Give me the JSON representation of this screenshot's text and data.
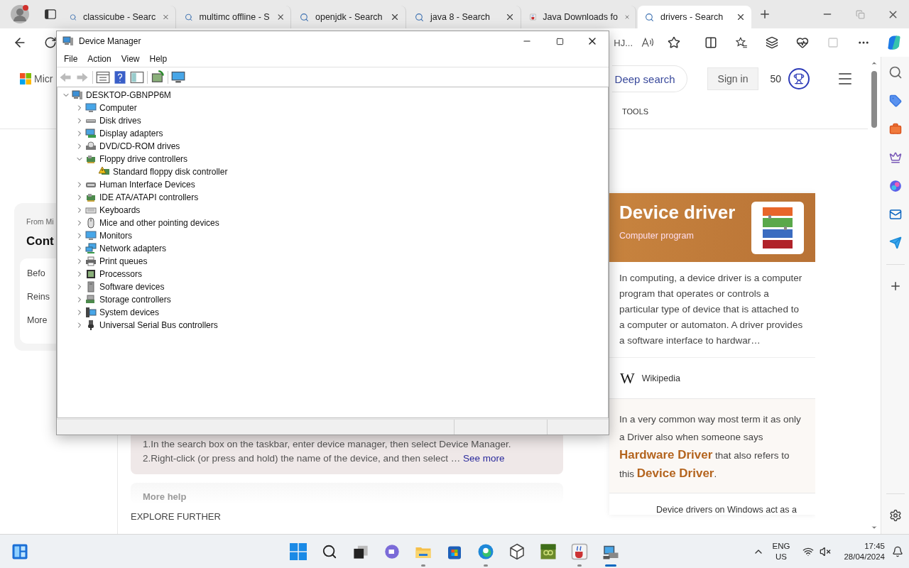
{
  "browser": {
    "tabs": [
      {
        "title": "classicube - Searc",
        "kind": "search",
        "selected": false
      },
      {
        "title": "multimc offline - S",
        "kind": "search",
        "selected": false
      },
      {
        "title": "openjdk - Search",
        "kind": "search",
        "selected": false
      },
      {
        "title": "java 8 - Search",
        "kind": "search",
        "selected": false
      },
      {
        "title": "Java Downloads fo",
        "kind": "page",
        "selected": false
      },
      {
        "title": "drivers - Search",
        "kind": "search",
        "selected": true
      }
    ],
    "address_tail": "HJ..."
  },
  "page": {
    "logo_text": "Micr",
    "deep_search": "Deep search",
    "sign_in": "Sign in",
    "points": "50",
    "tools": "TOOLS",
    "side_card": {
      "source": "From Mi",
      "title": "Cont",
      "items": [
        "Befo",
        "Reins",
        "More"
      ]
    },
    "steps": [
      "1.In the search box on the taskbar, enter device manager, then select Device Manager.",
      "2.Right-click (or press and hold) the name of the device, and then select …"
    ],
    "see_more": "See more",
    "more_help": "More help",
    "explore": "EXPLORE FURTHER",
    "knowledge": {
      "title": "Device driver",
      "subtitle": "Computer program",
      "description": "In computing, a device driver is a computer program that operates or controls a particular type of device that is attached to a computer or automaton. A driver provides a software interface to hardwar…",
      "source_logo": "W",
      "source": "Wikipedia",
      "fact": "In a very common way most term it as only a Driver also when someone says **Hardware Driver** that also refers to this **Device Driver**.",
      "more": "Device drivers on Windows act as a"
    }
  },
  "device_manager": {
    "title": "Device Manager",
    "menu": [
      "File",
      "Action",
      "View",
      "Help"
    ],
    "tree": {
      "label": "DESKTOP-GBNPP6M",
      "expanded": true,
      "children": [
        {
          "label": "Computer",
          "expanded": false
        },
        {
          "label": "Disk drives",
          "expanded": false
        },
        {
          "label": "Display adapters",
          "expanded": false
        },
        {
          "label": "DVD/CD-ROM drives",
          "expanded": false
        },
        {
          "label": "Floppy drive controllers",
          "expanded": true,
          "children": [
            {
              "label": "Standard floppy disk controller"
            }
          ]
        },
        {
          "label": "Human Interface Devices",
          "expanded": false
        },
        {
          "label": "IDE ATA/ATAPI controllers",
          "expanded": false
        },
        {
          "label": "Keyboards",
          "expanded": false
        },
        {
          "label": "Mice and other pointing devices",
          "expanded": false
        },
        {
          "label": "Monitors",
          "expanded": false
        },
        {
          "label": "Network adapters",
          "expanded": false
        },
        {
          "label": "Print queues",
          "expanded": false
        },
        {
          "label": "Processors",
          "expanded": false
        },
        {
          "label": "Software devices",
          "expanded": false
        },
        {
          "label": "Storage controllers",
          "expanded": false
        },
        {
          "label": "System devices",
          "expanded": false
        },
        {
          "label": "Universal Serial Bus controllers",
          "expanded": false
        }
      ]
    }
  },
  "taskbar": {
    "apps": [
      {
        "running": false,
        "active": false
      },
      {
        "running": true,
        "active": false
      },
      {
        "running": false,
        "active": false
      },
      {
        "running": true,
        "active": false
      },
      {
        "running": false,
        "active": false
      },
      {
        "running": false,
        "active": false
      },
      {
        "running": true,
        "active": false
      },
      {
        "running": true,
        "active": true
      }
    ],
    "language": "ENG",
    "region": "US",
    "time": "17:45",
    "date": "28/04/2024"
  }
}
